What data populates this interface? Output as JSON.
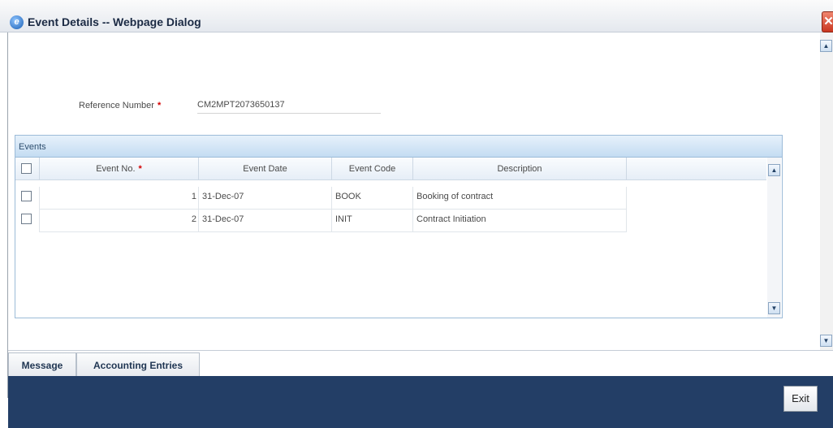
{
  "window": {
    "title": "Event Details -- Webpage Dialog",
    "close_glyph": "✕"
  },
  "form": {
    "reference_label": "Reference Number",
    "required_mark": "*",
    "reference_value": "CM2MPT2073650137"
  },
  "events": {
    "section_title": "Events",
    "columns": [
      "Event No.",
      "Event Date",
      "Event Code",
      "Description"
    ],
    "rows": [
      {
        "event_no": "1",
        "event_date": "31-Dec-07",
        "event_code": "BOOK",
        "description": "Booking of contract"
      },
      {
        "event_no": "2",
        "event_date": "31-Dec-07",
        "event_code": "INIT",
        "description": "Contract Initiation"
      }
    ],
    "scroll_up_glyph": "▲",
    "scroll_down_glyph": "▼"
  },
  "tabs": [
    {
      "label": "Message"
    },
    {
      "label": "Accounting Entries"
    }
  ],
  "footer": {
    "exit_label": "Exit"
  },
  "colors": {
    "footer_bg": "#233e66",
    "required": "#d30000",
    "header_bg": "#c4dcf2"
  }
}
